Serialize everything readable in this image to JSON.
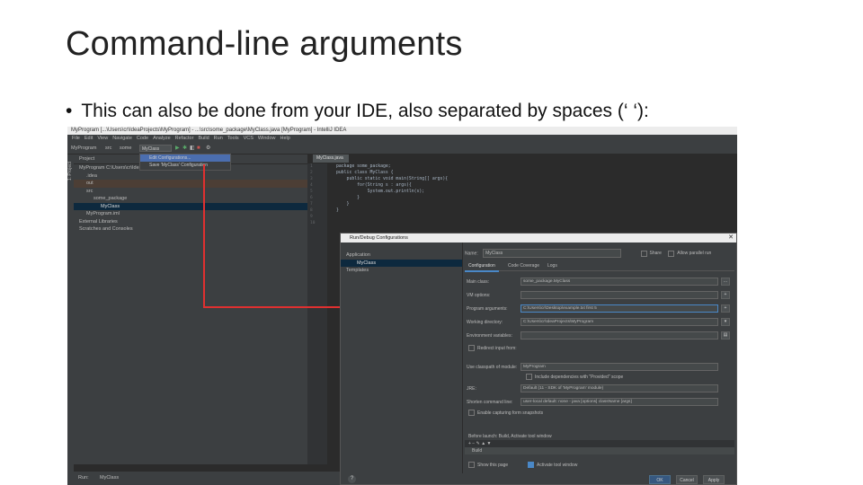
{
  "slide": {
    "title": "Command-line arguments",
    "bullet": "This can also be done from your IDE, also separated by spaces (‘ ‘):"
  },
  "ide": {
    "window_title": "MyProgram [...\\Users\\cr\\IdeaProjects\\MyProgram] - ...\\src\\some_package\\MyClass.java [MyProgram] - IntelliJ IDEA",
    "menu": [
      "File",
      "Edit",
      "View",
      "Navigate",
      "Code",
      "Analyze",
      "Refactor",
      "Build",
      "Run",
      "Tools",
      "VCS",
      "Window",
      "Help"
    ],
    "toolbar": {
      "project_crumb": "MyProgram",
      "src_crumb": "src",
      "pkg_crumb": "some",
      "run_config": "MyClass"
    },
    "run_dropdown": {
      "items": [
        "Edit Configurations...",
        "Save 'MyClass' Configuration"
      ],
      "extra": "MyClass"
    },
    "sidebar_label": "1: Project",
    "project_panel": {
      "header": "Project",
      "tree": [
        {
          "label": "MyProgram C:\\Users\\cr\\IdeaProjects\\MyProgram",
          "indent": 1,
          "state": "normal"
        },
        {
          "label": ".idea",
          "indent": 2,
          "state": "normal"
        },
        {
          "label": "out",
          "indent": 2,
          "state": "exclude"
        },
        {
          "label": "src",
          "indent": 2,
          "state": "normal"
        },
        {
          "label": "some_package",
          "indent": 3,
          "state": "normal"
        },
        {
          "label": "MyClass",
          "indent": 4,
          "state": "selected"
        },
        {
          "label": "MyProgram.iml",
          "indent": 2,
          "state": "normal"
        },
        {
          "label": "External Libraries",
          "indent": 1,
          "state": "normal"
        },
        {
          "label": "Scratches and Consoles",
          "indent": 1,
          "state": "normal"
        }
      ]
    },
    "editor": {
      "tab": "MyClass.java",
      "line_numbers": "1\n2\n3\n4\n5\n6\n7\n8\n9\n10",
      "code_lines": [
        "package some_package;",
        "",
        "public class MyClass {",
        "    public static void main(String[] args){",
        "        for(String s : args){",
        "            System.out.println(s);",
        "        }",
        "    }",
        "}",
        ""
      ]
    },
    "bottom": {
      "run_label": "Run:",
      "run_tab": "MyClass"
    }
  },
  "dialog": {
    "title": "Run/Debug Configurations",
    "close": "✕",
    "left_tree": [
      {
        "label": "Application",
        "indent": 1
      },
      {
        "label": "MyClass",
        "indent": 2,
        "selected": true
      },
      {
        "label": "Templates",
        "indent": 1
      }
    ],
    "name_label": "Name:",
    "name_value": "MyClass",
    "share_label": "Share",
    "parallel_label": "Allow parallel run",
    "tabs": [
      "Configuration",
      "Code Coverage",
      "Logs"
    ],
    "fields": [
      {
        "label": "Main class:",
        "value": "some_package.MyClass",
        "button": "..."
      },
      {
        "label": "VM options:",
        "value": "",
        "button": "+"
      },
      {
        "label": "Program arguments:",
        "value": "C:\\Users\\cr\\Desktop\\example.txt first 5",
        "button": "+"
      },
      {
        "label": "Working directory:",
        "value": "C:\\Users\\cr\\IdeaProjects\\MyProgram",
        "button": "▾"
      },
      {
        "label": "Environment variables:",
        "value": "",
        "button": "▤"
      }
    ],
    "redirect_label": "Redirect input from:",
    "classpath_label": "Use classpath of module:",
    "classpath_value": "MyProgram",
    "provided_label": "Include dependencies with \"Provided\" scope",
    "jre_label": "JRE:",
    "jre_value": "Default (11 - SDK of 'MyProgram' module)",
    "shorten_label": "Shorten command line:",
    "shorten_value": "user-local default: none - java [options] className [args]",
    "snapshots_label": "Enable capturing form snapshots",
    "before_launch": "Before launch: Build, Activate tool window",
    "before_bar": "+  −  ✎  ▲  ▼",
    "build_item": "Build",
    "show_page": "Show this page",
    "activate_tool": "Activate tool window",
    "help": "?",
    "buttons": {
      "ok": "OK",
      "cancel": "Cancel",
      "apply": "Apply"
    }
  },
  "colors": {
    "annotation": "#e03030",
    "selection": "#0d293e",
    "accent": "#4a88c7"
  }
}
